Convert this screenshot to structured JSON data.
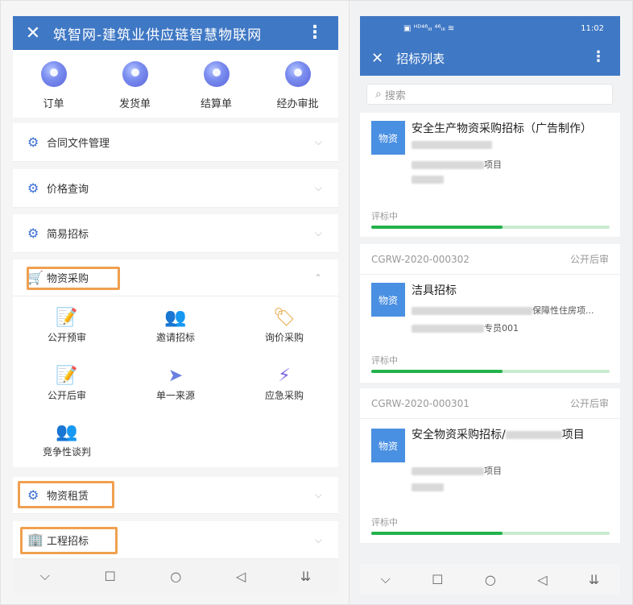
{
  "left": {
    "header": {
      "title": "筑智网-建筑业供应链智慧物联网",
      "close": "✕",
      "more": "⋮"
    },
    "quick": [
      {
        "label": "订单",
        "icon": "order-icon"
      },
      {
        "label": "发货单",
        "icon": "shipment-icon"
      },
      {
        "label": "结算单",
        "icon": "settlement-icon"
      },
      {
        "label": "经办审批",
        "icon": "approval-icon"
      }
    ],
    "sections": [
      {
        "label": "合同文件管理",
        "chev": "⌵"
      },
      {
        "label": "价格查询",
        "chev": "⌵"
      },
      {
        "label": "简易招标",
        "chev": "⌵"
      },
      {
        "label": "物资采购",
        "chev": "⌃"
      }
    ],
    "grid": [
      {
        "label": "公开预审",
        "icon": "📝"
      },
      {
        "label": "邀请招标",
        "icon": "👥"
      },
      {
        "label": "询价采购",
        "icon": "🏷"
      },
      {
        "label": "公开后审",
        "icon": "📝"
      },
      {
        "label": "单一来源",
        "icon": "➤"
      },
      {
        "label": "应急采购",
        "icon": "⚡"
      },
      {
        "label": "竞争性谈判",
        "icon": "👥"
      }
    ],
    "bottom_sections": [
      {
        "label": "物资租赁",
        "chev": "⌵"
      },
      {
        "label": "工程招标",
        "chev": "⌵"
      }
    ],
    "nav": [
      "⌵",
      "☐",
      "○",
      "◁",
      "⇊"
    ]
  },
  "right": {
    "status": {
      "left": "▣ ᴴᴰ⁴⁶ᵢₗₗ ⁴⁶ᵢₗₗ ≋",
      "time": "11:02"
    },
    "header": {
      "title": "招标列表",
      "close": "✕",
      "more": "⋮"
    },
    "search": {
      "placeholder": "搜索",
      "icon": "⌕"
    },
    "cards": [
      {
        "code": "",
        "status": "",
        "badge": "物资",
        "title": "安全生产物资采购招标（广告制作）",
        "sub": "项目",
        "progress_label": "评标中",
        "progress": 0.55
      },
      {
        "code": "CGRW-2020-000302",
        "status": "公开后审",
        "badge": "物资",
        "title": "洁具招标",
        "sub": "保障性住房项...",
        "sub2": "专员001",
        "progress_label": "评标中",
        "progress": 0.55
      },
      {
        "code": "CGRW-2020-000301",
        "status": "公开后审",
        "badge": "物资",
        "title": "安全物资采购招标/",
        "title_tail": "项目",
        "sub": "项目",
        "progress_label": "评标中",
        "progress": 0.55
      }
    ],
    "nav": [
      "⌵",
      "☐",
      "○",
      "◁",
      "⇊"
    ]
  }
}
